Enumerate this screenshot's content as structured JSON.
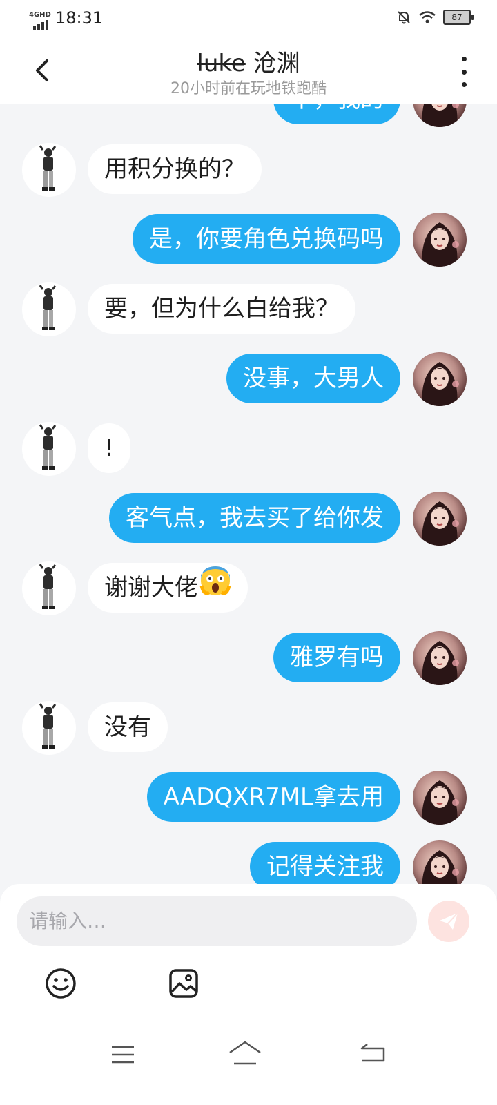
{
  "status_bar": {
    "network": "4GHD",
    "time": "18:31",
    "battery": "87"
  },
  "header": {
    "name_strike": "luke",
    "name": "沧渊",
    "status": "20小时前在玩地铁跑酷"
  },
  "messages": [
    {
      "side": "right",
      "text": "不，我的"
    },
    {
      "side": "left",
      "text": "用积分换的？"
    },
    {
      "side": "right",
      "text": "是，你要角色兑换码吗"
    },
    {
      "side": "left",
      "text": "要，但为什么白给我？"
    },
    {
      "side": "right",
      "text": "没事，大男人"
    },
    {
      "side": "left",
      "text": "!"
    },
    {
      "side": "right",
      "text": "客气点，我去买了给你发"
    },
    {
      "side": "left",
      "text": "谢谢大佬",
      "emoji": "scream-face"
    },
    {
      "side": "right",
      "text": "雅罗有吗"
    },
    {
      "side": "left",
      "text": "没有"
    },
    {
      "side": "right",
      "text": "AADQXR7ML拿去用"
    },
    {
      "side": "right",
      "text": "记得关注我"
    }
  ],
  "input": {
    "placeholder": "请输入…"
  },
  "icons": {
    "back": "chevron-left-icon",
    "more": "more-vertical-icon",
    "send": "send-icon",
    "emoji": "smiley-icon",
    "image": "image-icon"
  },
  "colors": {
    "outgoing_bubble": "#23adf2",
    "incoming_bubble": "#ffffff",
    "background": "#f4f5f7",
    "send_button": "#fde3e0"
  }
}
